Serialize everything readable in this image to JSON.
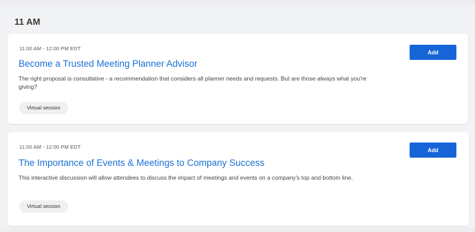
{
  "section": {
    "header": "11 AM"
  },
  "sessions": [
    {
      "time": "11:00 AM - 12:00 PM EDT",
      "title": "Become a Trusted Meeting Planner Advisor",
      "description": "The right proposal is consultative - a recommendation that considers all planner needs and requests. But are those always what you're giving?",
      "badge": "Virtual session",
      "add_label": "Add"
    },
    {
      "time": "11:00 AM - 12:00 PM EDT",
      "title": "The Importance of Events & Meetings to Company Success",
      "description": "This interactive discussion will allow attendees to discuss the impact of meetings and events on a company's top and bottom line.",
      "badge": "Virtual session",
      "add_label": "Add"
    }
  ],
  "colors": {
    "accent": "#1565d8",
    "title_link": "#1a6fd6",
    "background": "#f2f3f5",
    "card": "#ffffff",
    "badge_bg": "#f0f0f0"
  }
}
